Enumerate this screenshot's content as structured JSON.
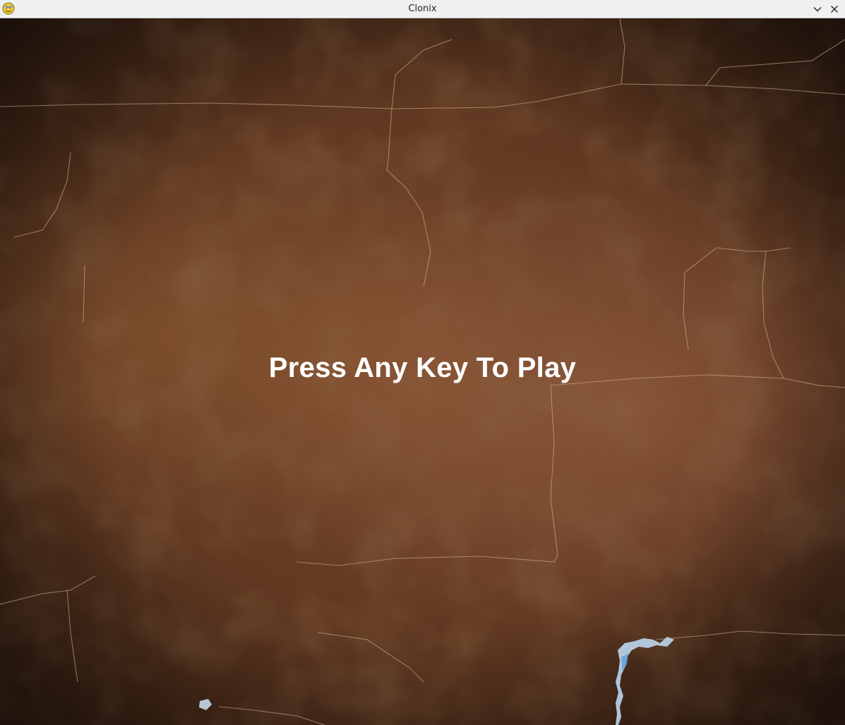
{
  "window": {
    "title": "Clonix",
    "icon": "python-snake-icon",
    "controls": [
      "minimize-chevron-icon",
      "close-icon"
    ]
  },
  "game": {
    "prompt": "Press Any Key To Play",
    "prompt_color": "#ffffff",
    "background_style": "cracked brown wall texture"
  }
}
